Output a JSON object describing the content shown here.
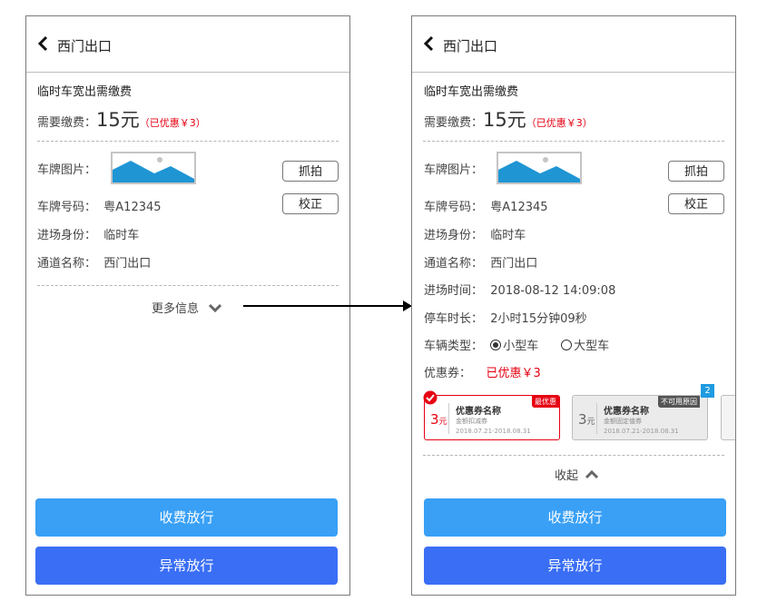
{
  "left": {
    "header_title": "西门出口",
    "section_title": "临时车宽出需缴费",
    "fee_label": "需要缴费：",
    "fee_amount": "15元",
    "fee_discount": "（已优惠￥3）",
    "plate_img_label": "车牌图片：",
    "capture_btn": "抓拍",
    "plate_no_label": "车牌号码：",
    "plate_no": "粤A12345",
    "correct_btn": "校正",
    "identity_label": "进场身份：",
    "identity": "临时车",
    "channel_label": "通道名称：",
    "channel": "西门出口",
    "more_info": "更多信息",
    "pay_btn": "收费放行",
    "abnormal_btn": "异常放行"
  },
  "right": {
    "header_title": "西门出口",
    "section_title": "临时车宽出需缴费",
    "fee_label": "需要缴费：",
    "fee_amount": "15元",
    "fee_discount": "（已优惠￥3）",
    "plate_img_label": "车牌图片：",
    "capture_btn": "抓拍",
    "plate_no_label": "车牌号码：",
    "plate_no": "粤A12345",
    "correct_btn": "校正",
    "identity_label": "进场身份：",
    "identity": "临时车",
    "channel_label": "通道名称：",
    "channel": "西门出口",
    "entry_time_label": "进场时间：",
    "entry_time": "2018-08-12 14:09:08",
    "duration_label": "停车时长：",
    "duration": "2小时15分钟09秒",
    "vehicle_type_label": "车辆类型：",
    "vehicle_small": "小型车",
    "vehicle_large": "大型车",
    "coupon_label": "优惠券：",
    "coupon_value": "已优惠￥3",
    "coupons": [
      {
        "amount": "3",
        "unit": "元",
        "name": "优惠券名称",
        "type": "金额扣减券",
        "date": "2018.07.21-2018.08.31",
        "tag": "最优惠"
      },
      {
        "amount": "3",
        "unit": "元",
        "name": "优惠券名称",
        "type": "金额固定值券",
        "date": "2018.07.21-2018.08.31",
        "tag": "不可用原因",
        "count": "2"
      }
    ],
    "collapse": "收起",
    "pay_btn": "收费放行",
    "abnormal_btn": "异常放行"
  },
  "colors": {
    "accent_red": "#e60012",
    "pay_blue": "#39a0f6",
    "abnormal_blue": "#3a6ef5",
    "picture_blue": "#1f95d4",
    "badge_blue": "#1e9be0"
  },
  "icons": [
    "back-arrow-icon",
    "chevron-down-icon",
    "chevron-up-icon",
    "check-circle-icon",
    "image-placeholder-icon",
    "arrow-right-icon"
  ]
}
